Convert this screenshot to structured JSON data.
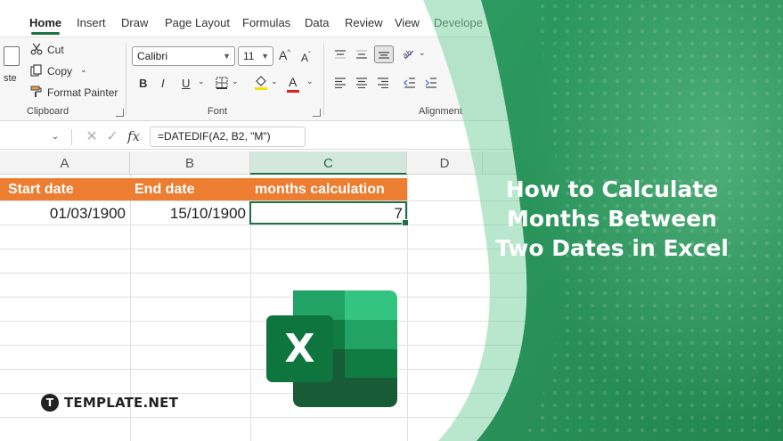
{
  "ribbon_tabs": [
    "Home",
    "Insert",
    "Draw",
    "Page Layout",
    "Formulas",
    "Data",
    "Review",
    "View",
    "Develope"
  ],
  "clipboard": {
    "paste_label": "ste",
    "cut_label": "Cut",
    "copy_label": "Copy",
    "format_painter_label": "Format Painter",
    "group_label": "Clipboard"
  },
  "font": {
    "family": "Calibri",
    "size": "11",
    "group_label": "Font",
    "bold": "B",
    "italic": "I",
    "underline": "U",
    "font_color_letter": "A",
    "grow": "A",
    "shrink": "A"
  },
  "alignment": {
    "group_label": "Alignment"
  },
  "formula_bar": {
    "formula": "=DATEDIF(A2, B2, \"M\")",
    "fx": "fx"
  },
  "columns": [
    "A",
    "B",
    "C",
    "D"
  ],
  "sheet": {
    "headers": [
      "Start date",
      "End date",
      "months calculation"
    ],
    "row": [
      "01/03/1900",
      "15/10/1900",
      "7"
    ]
  },
  "headline": [
    "How to Calculate",
    "Months Between",
    "Two Dates in Excel"
  ],
  "logo_letter": "X",
  "brand": {
    "mark": "T",
    "name": "TEMPLATE.NET"
  },
  "colors": {
    "excel_green": "#1e7145",
    "header_orange": "#ed7d31",
    "panel_green": "#2e9e62",
    "panel_light": "#5bbf85"
  }
}
